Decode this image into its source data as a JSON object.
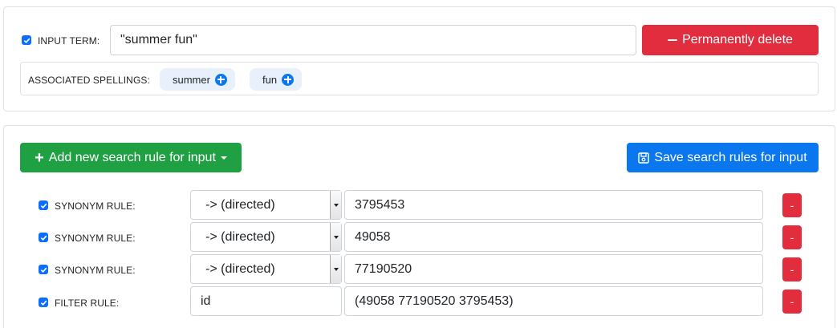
{
  "input_term": {
    "checked": true,
    "label": "INPUT TERM:",
    "value": "\"summer fun\"",
    "delete_button_label": "Permanently delete"
  },
  "associated_spellings": {
    "label": "ASSOCIATED SPELLINGS:",
    "chips": [
      "summer",
      "fun"
    ]
  },
  "toolbar": {
    "add_rule_label": "Add new search rule for input",
    "save_rules_label": "Save search rules for input"
  },
  "rules": [
    {
      "checked": true,
      "label": "SYNONYM RULE:",
      "type_value": "-> (directed)",
      "term": "3795453",
      "remove_label": "-"
    },
    {
      "checked": true,
      "label": "SYNONYM RULE:",
      "type_value": "-> (directed)",
      "term": "49058",
      "remove_label": "-"
    },
    {
      "checked": true,
      "label": "SYNONYM RULE:",
      "type_value": "-> (directed)",
      "term": "77190520",
      "remove_label": "-"
    },
    {
      "checked": true,
      "label": "FILTER RULE:",
      "field": "id",
      "term": "(49058 77190520 3795453)",
      "remove_label": "-"
    }
  ],
  "colors": {
    "danger": "#e22d3f",
    "success": "#1fa043",
    "primary": "#0a77ef",
    "chip_bg": "#e7f0fb"
  }
}
